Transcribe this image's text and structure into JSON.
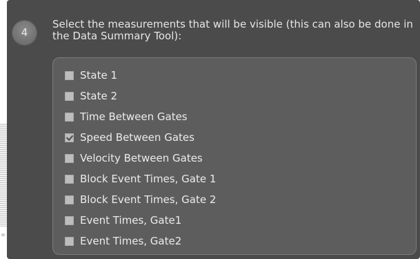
{
  "step": {
    "number": "4",
    "instruction": "Select the measurements that will be visible (this can also be done in the Data Summary Tool):"
  },
  "measurements": [
    {
      "label": "State 1",
      "checked": false
    },
    {
      "label": "State 2",
      "checked": false
    },
    {
      "label": "Time Between Gates",
      "checked": false
    },
    {
      "label": "Speed Between Gates",
      "checked": true
    },
    {
      "label": "Velocity Between Gates",
      "checked": false
    },
    {
      "label": "Block Event Times, Gate 1",
      "checked": false
    },
    {
      "label": "Block Event Times, Gate 2",
      "checked": false
    },
    {
      "label": "Event Times, Gate1",
      "checked": false
    },
    {
      "label": "Event Times, Gate2",
      "checked": false
    }
  ]
}
